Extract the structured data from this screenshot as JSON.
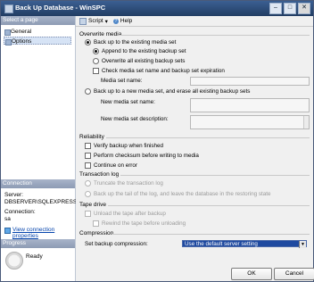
{
  "window": {
    "title": "Back Up Database - WinSPC"
  },
  "sidebar": {
    "select_page_header": "Select a page",
    "items": [
      {
        "label": "General"
      },
      {
        "label": "Options"
      }
    ],
    "connection_header": "Connection",
    "server_label": "Server:",
    "server_value": "DBSERVER\\SQLEXPRESS",
    "connection_label": "Connection:",
    "connection_value": "sa",
    "view_connection_properties": "View connection properties",
    "progress_header": "Progress",
    "progress_status": "Ready"
  },
  "toolbar": {
    "script_label": "Script",
    "help_label": "Help"
  },
  "overwrite_media": {
    "title": "Overwrite media",
    "backup_existing": "Back up to the existing media set",
    "append": "Append to the existing backup set",
    "overwrite_all": "Overwrite all existing backup sets",
    "check_name_expiration": "Check media set name and backup set expiration",
    "media_set_name": "Media set name:",
    "backup_new": "Back up to a new media set, and erase all existing backup sets",
    "new_media_set_name": "New media set name:",
    "new_media_set_description": "New media set description:"
  },
  "reliability": {
    "title": "Reliability",
    "verify": "Verify backup when finished",
    "checksum": "Perform checksum before writing to media",
    "continue_error": "Continue on error"
  },
  "transaction_log": {
    "title": "Transaction log",
    "truncate": "Truncate the transaction log",
    "tail": "Back up the tail of the log, and leave the database in the restoring state"
  },
  "tape_drive": {
    "title": "Tape drive",
    "unload": "Unload the tape after backup",
    "rewind": "Rewind the tape before unloading"
  },
  "compression": {
    "title": "Compression",
    "label": "Set backup compression:",
    "value": "Use the default server setting"
  },
  "buttons": {
    "ok": "OK",
    "cancel": "Cancel"
  }
}
